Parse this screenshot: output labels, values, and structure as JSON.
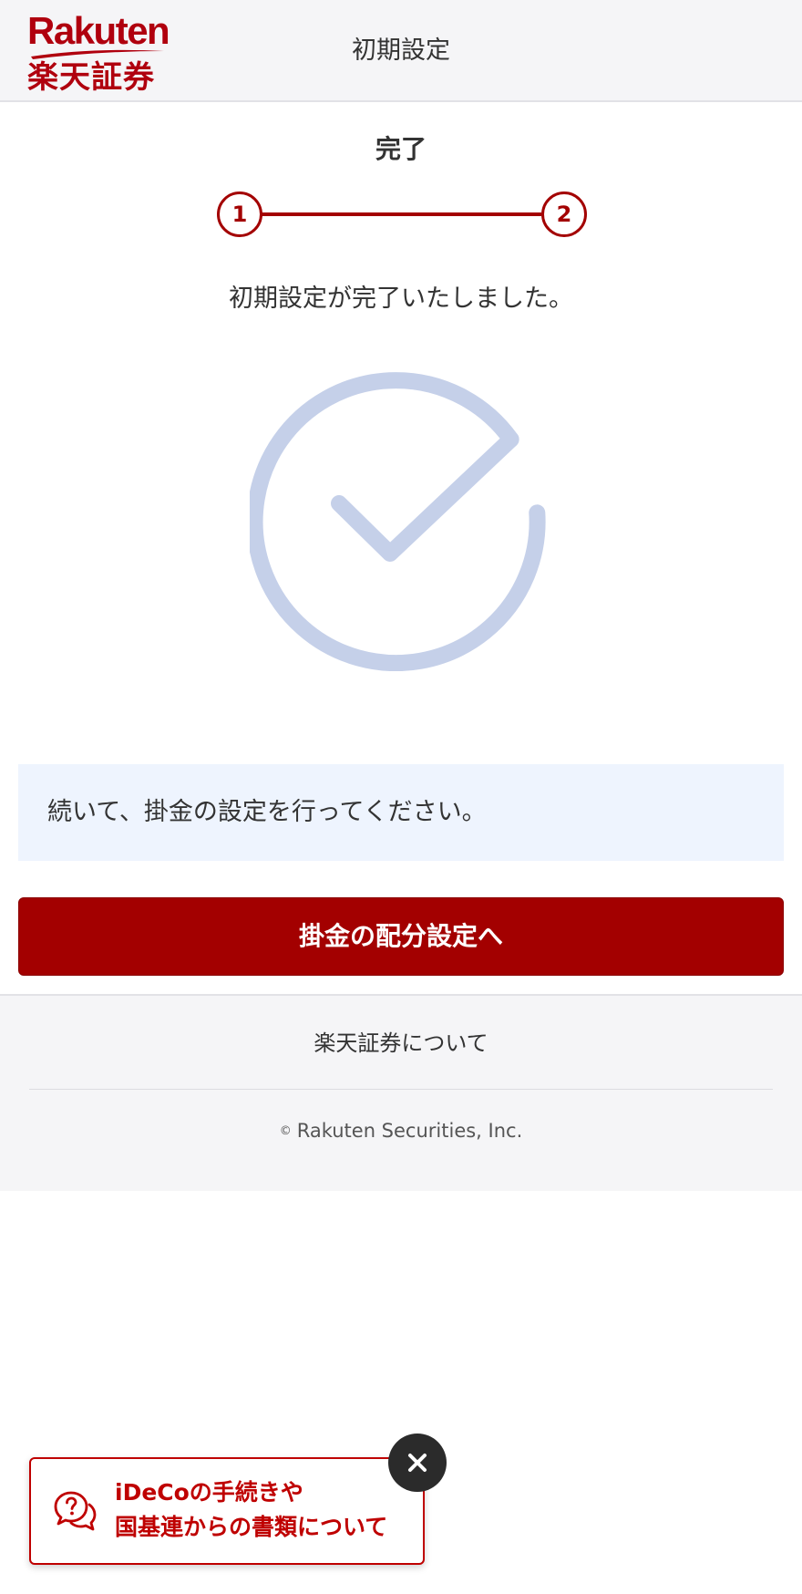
{
  "header": {
    "logo_word": "Rakuten",
    "logo_jp": "楽天証券",
    "title": "初期設定"
  },
  "steps": {
    "current_label": "完了",
    "items": [
      "1",
      "2"
    ],
    "current": 2
  },
  "main": {
    "message": "初期設定が完了いたしました。",
    "info": "続いて、掛金の設定を行ってください。",
    "button_label": "掛金の配分設定へ"
  },
  "footer": {
    "link": "楽天証券について",
    "copyright_symbol": "©",
    "copyright_text": "Rakuten Securities, Inc."
  },
  "help_banner": {
    "line1": "iDeCoの手続きや",
    "line2": "国基連からの書類について",
    "icon": "chat-question-icon",
    "close_icon": "close-icon"
  },
  "colors": {
    "brand": "#a30000",
    "check": "#c5d0e9",
    "info_bg": "#eef4fe",
    "banner": "#bf0000"
  }
}
